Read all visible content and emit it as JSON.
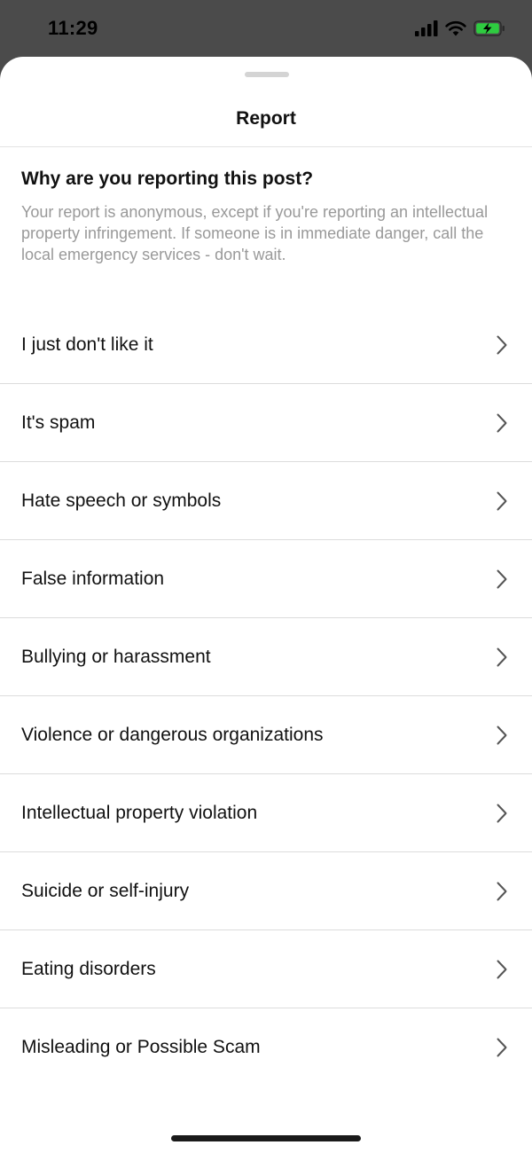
{
  "status_bar": {
    "time": "11:29",
    "icons": [
      "signal-icon",
      "wifi-icon",
      "battery-charging-icon"
    ],
    "battery_color": "#2ecc40"
  },
  "sheet": {
    "title": "Report",
    "question": "Why are you reporting this post?",
    "subtext": "Your report is anonymous, except if you're reporting an intellectual property infringement. If someone is in immediate danger, call the local emergency services - don't wait."
  },
  "options": [
    {
      "label": "I just don't like it"
    },
    {
      "label": "It's spam"
    },
    {
      "label": "Hate speech or symbols"
    },
    {
      "label": "False information"
    },
    {
      "label": "Bullying or harassment"
    },
    {
      "label": "Violence or dangerous organizations"
    },
    {
      "label": "Intellectual property violation"
    },
    {
      "label": "Suicide or self-injury"
    },
    {
      "label": "Eating disorders"
    },
    {
      "label": "Misleading or Possible Scam"
    }
  ],
  "colors": {
    "backdrop": "#4b4b4b",
    "text_primary": "#111111",
    "text_secondary": "#999999",
    "divider": "#dcdcdc"
  }
}
